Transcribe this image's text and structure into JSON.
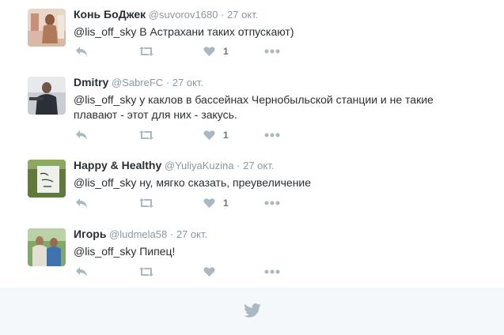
{
  "tweets": [
    {
      "fullname": "Конь БоДжек",
      "username": "@suvorov1680",
      "separator": "·",
      "time": "27 окт.",
      "text": "@lis_off_sky В Астрахани таких отпускают)",
      "likes": "1"
    },
    {
      "fullname": "Dmitry",
      "username": "@SabreFC",
      "separator": "·",
      "time": "27 окт.",
      "text": "@lis_off_sky у каклов в бассейнах Чернобыльской станции и не такие плавают - этот для них - закусь.",
      "likes": "1"
    },
    {
      "fullname": "Happy & Healthy",
      "username": "@YuliyaKuzina",
      "separator": "·",
      "time": "27 окт.",
      "text": "@lis_off_sky ну, мягко сказать, преувеличение",
      "likes": "1"
    },
    {
      "fullname": "Игорь",
      "username": "@ludmela58",
      "separator": "·",
      "time": "27 окт.",
      "text": "@lis_off_sky Пипец!",
      "likes": ""
    }
  ],
  "icons": {
    "reply": "reply-icon",
    "retweet": "retweet-icon",
    "like": "heart-icon",
    "more": "more-icon",
    "footer": "twitter-bird-icon"
  },
  "colors": {
    "action_icon": "#aab8c2",
    "username": "#8899a6",
    "text": "#292f33",
    "footer_bg": "#f5f8fa"
  }
}
